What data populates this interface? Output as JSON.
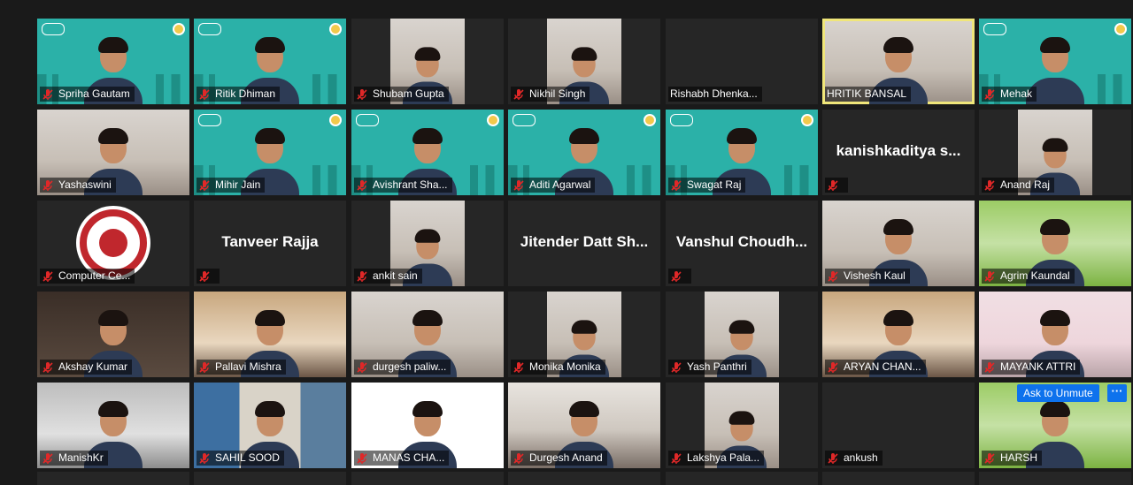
{
  "colors": {
    "active_speaker": "#f0e67a",
    "mute_icon": "#e02828",
    "unmute_button": "#0e72ed"
  },
  "participants": [
    {
      "name": "Spriha Gautam",
      "muted": true,
      "style": "teal"
    },
    {
      "name": "Ritik Dhiman",
      "muted": true,
      "style": "teal"
    },
    {
      "name": "Shubam Gupta",
      "muted": true,
      "style": "photo"
    },
    {
      "name": "Nikhil Singh",
      "muted": true,
      "style": "photo"
    },
    {
      "name": "Rishabh Dhenka...",
      "muted": false,
      "style": "dark-empty"
    },
    {
      "name": "HRITIK BANSAL",
      "muted": false,
      "style": "room",
      "active": true
    },
    {
      "name": "Mehak",
      "muted": true,
      "style": "teal"
    },
    {
      "name": "Yashaswini",
      "muted": true,
      "style": "room"
    },
    {
      "name": "Mihir Jain",
      "muted": true,
      "style": "teal"
    },
    {
      "name": "Avishrant Sha...",
      "muted": true,
      "style": "teal"
    },
    {
      "name": "Aditi Agarwal",
      "muted": true,
      "style": "teal"
    },
    {
      "name": "Swagat Raj",
      "muted": true,
      "style": "teal"
    },
    {
      "name": "",
      "muted": true,
      "style": "name-only",
      "big_name": "kanishkaditya s..."
    },
    {
      "name": "Anand Raj",
      "muted": true,
      "style": "photo"
    },
    {
      "name": "Computer Ce...",
      "muted": true,
      "style": "logo"
    },
    {
      "name": "",
      "muted": true,
      "style": "name-only",
      "big_name": "Tanveer Rajja"
    },
    {
      "name": "ankit sain",
      "muted": true,
      "style": "photo"
    },
    {
      "name": "",
      "muted": false,
      "style": "name-only",
      "big_name": "Jitender Datt Sh..."
    },
    {
      "name": "",
      "muted": true,
      "style": "name-only",
      "big_name": "Vanshul Choudh..."
    },
    {
      "name": "Vishesh Kaul",
      "muted": true,
      "style": "room"
    },
    {
      "name": "Agrim Kaundal",
      "muted": true,
      "style": "green"
    },
    {
      "name": "Akshay Kumar",
      "muted": true,
      "style": "dark"
    },
    {
      "name": "Pallavi Mishra",
      "muted": true,
      "style": "warm"
    },
    {
      "name": "durgesh paliw...",
      "muted": true,
      "style": "room"
    },
    {
      "name": "Monika Monika",
      "muted": true,
      "style": "photo"
    },
    {
      "name": "Yash Panthri",
      "muted": true,
      "style": "photo"
    },
    {
      "name": "ARYAN CHAN...",
      "muted": true,
      "style": "warm"
    },
    {
      "name": "MAYANK ATTRI",
      "muted": true,
      "style": "pink"
    },
    {
      "name": "ManishKr",
      "muted": true,
      "style": "grey"
    },
    {
      "name": "SAHIL SOOD",
      "muted": true,
      "style": "curtain"
    },
    {
      "name": "MANAS CHA...",
      "muted": true,
      "style": "white"
    },
    {
      "name": "Durgesh Anand",
      "muted": true,
      "style": "room2"
    },
    {
      "name": "Lakshya Pala...",
      "muted": true,
      "style": "photo"
    },
    {
      "name": "ankush",
      "muted": true,
      "style": "dark-empty"
    },
    {
      "name": "HARSH",
      "muted": true,
      "style": "green"
    }
  ],
  "controls": {
    "ask_to_unmute": "Ask to Unmute",
    "more": "···"
  }
}
